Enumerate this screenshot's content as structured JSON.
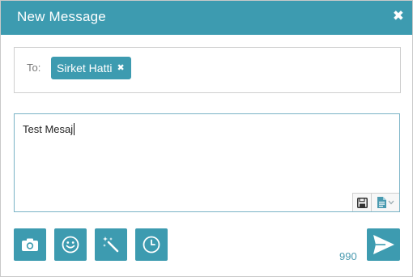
{
  "dialog": {
    "title": "New Message",
    "close_glyph": "✖"
  },
  "recipients": {
    "label": "To:",
    "items": [
      {
        "name": "Sirket Hatti",
        "remove_glyph": "✖"
      }
    ]
  },
  "message": {
    "text": "Test Mesaj"
  },
  "toolbar": {
    "icons": [
      "camera-icon",
      "smiley-icon",
      "magic-wand-icon",
      "clock-icon"
    ]
  },
  "counter": {
    "remaining": "990"
  },
  "colors": {
    "accent": "#3d9bb0",
    "counter_text": "#4a9ab0"
  }
}
